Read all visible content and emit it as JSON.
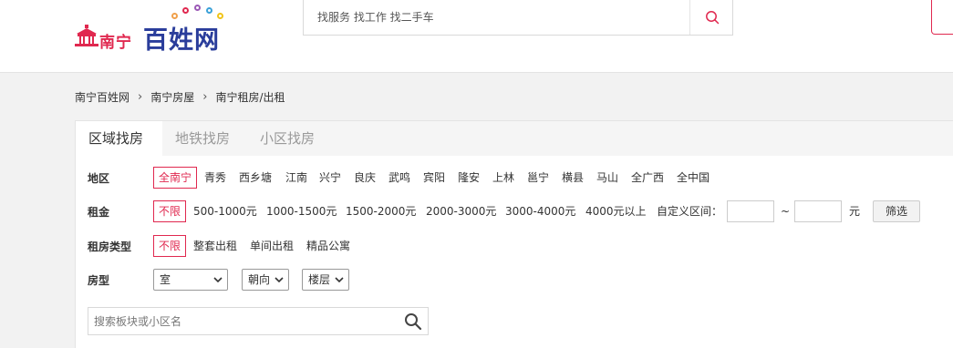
{
  "logo": {
    "city": "南宁",
    "brand": "百姓网",
    "colors": [
      "#f0a04b",
      "#e0284f",
      "#9b59b6",
      "#3aa1d8",
      "#f0c419"
    ]
  },
  "header": {
    "search_placeholder": "找服务 找工作 找二手车",
    "search_icon": "search-icon",
    "accent_color": "#e0284f"
  },
  "breadcrumb": {
    "items": [
      "南宁百姓网",
      "南宁房屋",
      "南宁租房/出租"
    ],
    "separator": "›"
  },
  "tabs": [
    "区域找房",
    "地铁找房",
    "小区找房"
  ],
  "filters": {
    "region": {
      "label": "地区",
      "options": [
        "全南宁",
        "青秀",
        "西乡塘",
        "江南",
        "兴宁",
        "良庆",
        "武鸣",
        "宾阳",
        "隆安",
        "上林",
        "邕宁",
        "横县",
        "马山",
        "全广西",
        "全中国"
      ]
    },
    "rent": {
      "label": "租金",
      "options": [
        "不限",
        "500-1000元",
        "1000-1500元",
        "1500-2000元",
        "2000-3000元",
        "3000-4000元",
        "4000元以上"
      ],
      "custom_label": "自定义区间：",
      "tilde": "~",
      "unit": "元",
      "button": "筛选"
    },
    "rent_type": {
      "label": "租房类型",
      "options": [
        "不限",
        "整套出租",
        "单间出租",
        "精品公寓"
      ]
    },
    "layout": {
      "label": "房型",
      "selects": [
        "室",
        "朝向",
        "楼层"
      ]
    }
  },
  "area_search": {
    "placeholder": "搜索板块或小区名",
    "icon": "search-icon"
  }
}
